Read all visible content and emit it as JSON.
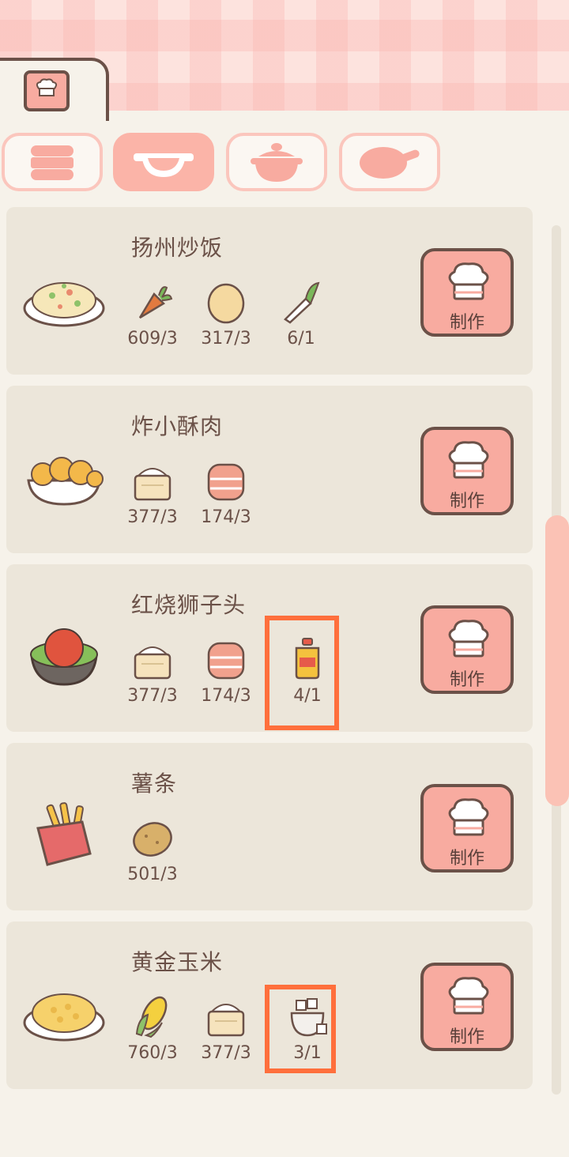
{
  "tabs": {
    "book_icon": "recipe-book-icon",
    "categories": [
      {
        "icon": "steamer-icon",
        "active": false
      },
      {
        "icon": "wok-icon",
        "active": true
      },
      {
        "icon": "clay-pot-icon",
        "active": false
      },
      {
        "icon": "frying-pan-icon",
        "active": false
      }
    ]
  },
  "make_label": "制作",
  "recipes": [
    {
      "name": "扬州炒饭",
      "dish_icon": "fried-rice-icon",
      "ingredients": [
        {
          "icon": "carrot-icon",
          "qty": "609/3"
        },
        {
          "icon": "egg-icon",
          "qty": "317/3"
        },
        {
          "icon": "scallion-icon",
          "qty": "6/1"
        }
      ]
    },
    {
      "name": "炸小酥肉",
      "dish_icon": "fried-pork-icon",
      "ingredients": [
        {
          "icon": "flour-icon",
          "qty": "377/3"
        },
        {
          "icon": "meat-icon",
          "qty": "174/3"
        }
      ]
    },
    {
      "name": "红烧狮子头",
      "dish_icon": "braised-meatball-icon",
      "ingredients": [
        {
          "icon": "flour-icon",
          "qty": "377/3"
        },
        {
          "icon": "meat-icon",
          "qty": "174/3"
        },
        {
          "icon": "oil-bottle-icon",
          "qty": "4/1",
          "highlighted": true
        }
      ]
    },
    {
      "name": "薯条",
      "dish_icon": "french-fries-icon",
      "ingredients": [
        {
          "icon": "potato-icon",
          "qty": "501/3"
        }
      ]
    },
    {
      "name": "黄金玉米",
      "dish_icon": "golden-corn-icon",
      "ingredients": [
        {
          "icon": "corn-icon",
          "qty": "760/3"
        },
        {
          "icon": "flour-icon",
          "qty": "377/3"
        },
        {
          "icon": "sugar-icon",
          "qty": "3/1",
          "highlighted": true
        }
      ]
    }
  ],
  "colors": {
    "accent": "#f8aba0",
    "highlight": "#ff6f3c",
    "text": "#6b5148"
  }
}
